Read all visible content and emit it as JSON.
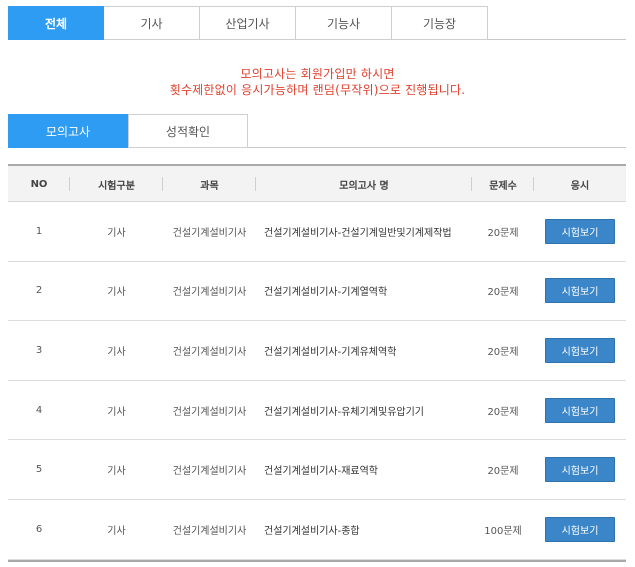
{
  "category_tabs": [
    {
      "label": "전체",
      "active": true
    },
    {
      "label": "기사",
      "active": false
    },
    {
      "label": "산업기사",
      "active": false
    },
    {
      "label": "기능사",
      "active": false
    },
    {
      "label": "기능장",
      "active": false
    }
  ],
  "notice": {
    "line1": "모의고사는 회원가입만 하시면",
    "line2": "횟수제한없이 응시가능하며 랜덤(무작위)으로 진행됩니다."
  },
  "sub_tabs": [
    {
      "label": "모의고사",
      "active": true
    },
    {
      "label": "성적확인",
      "active": false
    }
  ],
  "table": {
    "headers": [
      "NO",
      "시험구분",
      "과목",
      "모의고사 명",
      "문제수",
      "응시"
    ],
    "rows": [
      {
        "no": "1",
        "type": "기사",
        "subject": "건설기계설비기사",
        "name": "건설기계설비기사-건설기계일반및기계제작법",
        "count": "20문제",
        "action": "시험보기"
      },
      {
        "no": "2",
        "type": "기사",
        "subject": "건설기계설비기사",
        "name": "건설기계설비기사-기계열역학",
        "count": "20문제",
        "action": "시험보기"
      },
      {
        "no": "3",
        "type": "기사",
        "subject": "건설기계설비기사",
        "name": "건설기계설비기사-기계유체역학",
        "count": "20문제",
        "action": "시험보기"
      },
      {
        "no": "4",
        "type": "기사",
        "subject": "건설기계설비기사",
        "name": "건설기계설비기사-유체기계및유압기기",
        "count": "20문제",
        "action": "시험보기"
      },
      {
        "no": "5",
        "type": "기사",
        "subject": "건설기계설비기사",
        "name": "건설기계설비기사-재료역학",
        "count": "20문제",
        "action": "시험보기"
      },
      {
        "no": "6",
        "type": "기사",
        "subject": "건설기계설비기사",
        "name": "건설기계설비기사-종합",
        "count": "100문제",
        "action": "시험보기"
      }
    ]
  },
  "colors": {
    "accent": "#2e9cf2",
    "button": "#3a86c8",
    "notice": "#e0402e"
  }
}
